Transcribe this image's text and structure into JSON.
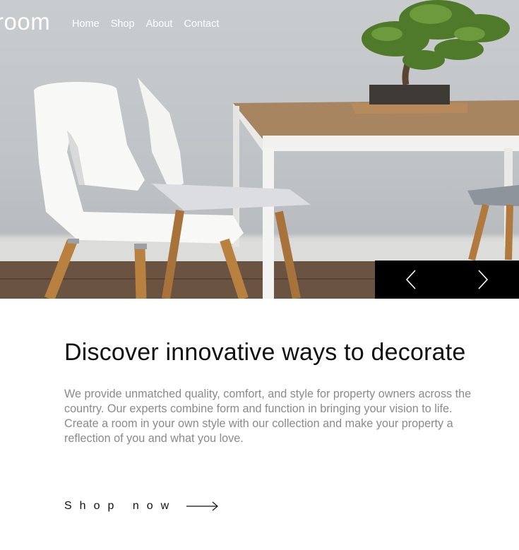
{
  "brand": {
    "logo": "room"
  },
  "nav": {
    "items": [
      "Home",
      "Shop",
      "About",
      "Contact"
    ]
  },
  "slider": {
    "prev_icon": "chevron-left-icon",
    "next_icon": "chevron-right-icon",
    "bg_color": "#000000"
  },
  "hero_image": {
    "subject": "white chairs, wooden table, bonsai"
  },
  "content": {
    "heading": "Discover innovative ways to decorate",
    "description": "We provide unmatched quality, comfort, and style for property owners across the country. Our experts combine form and function in bringing your vision to life. Create a room in your own style with our collection and make your property a reflection of you and what you love.",
    "cta_label": "Shop now",
    "cta_icon": "arrow-right-icon"
  }
}
